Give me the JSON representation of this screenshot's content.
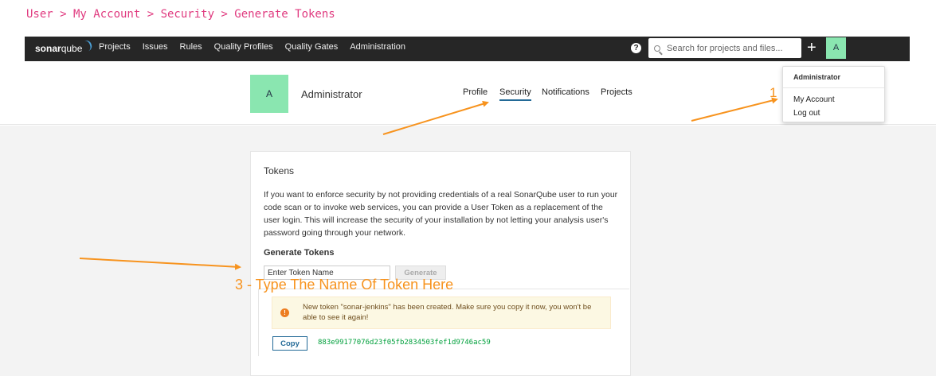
{
  "breadcrumb": "User > My Account > Security > Generate Tokens",
  "navbar": {
    "logo_bold": "sonar",
    "logo_light": "qube",
    "links": [
      "Projects",
      "Issues",
      "Rules",
      "Quality Profiles",
      "Quality Gates",
      "Administration"
    ],
    "help_glyph": "?",
    "search_placeholder": "Search for projects and files...",
    "plus_glyph": "+",
    "avatar_letter": "A"
  },
  "dropdown": {
    "title": "Administrator",
    "items": [
      "My Account",
      "Log out"
    ]
  },
  "profile": {
    "avatar_letter": "A",
    "name": "Administrator",
    "tabs": [
      "Profile",
      "Security",
      "Notifications",
      "Projects"
    ],
    "active_tab": "Security"
  },
  "tokens_card": {
    "title": "Tokens",
    "description": "If you want to enforce security by not providing credentials of a real SonarQube user to run your code scan or to invoke web services, you can provide a User Token as a replacement of the user login. This will increase the security of your installation by not letting your analysis user's password going through your network.",
    "generate_title": "Generate Tokens",
    "input_placeholder": "Enter Token Name",
    "generate_button": "Generate",
    "alert_glyph": "!",
    "alert_text": "New token \"sonar-jenkins\" has been created. Make sure you copy it now, you won't be able to see it again!",
    "copy_button": "Copy",
    "token_value": "883e99177076d23f05fb2834503fef1d9746ac59"
  },
  "annotations": {
    "step1": "1",
    "step3": "3 - Type The Name Of Token Here"
  },
  "colors": {
    "navbar_bg": "#262626",
    "avatar_bg": "#8ae6b0",
    "annotation": "#f7931e",
    "breadcrumb": "#e03a7f",
    "active_tab_underline": "#236a97",
    "token_text": "#00a03c",
    "alert_bg": "#fcf8e3"
  },
  "icons": {
    "help": "help-circle-icon",
    "search": "search-icon",
    "plus": "plus-icon",
    "alert": "exclamation-icon"
  }
}
